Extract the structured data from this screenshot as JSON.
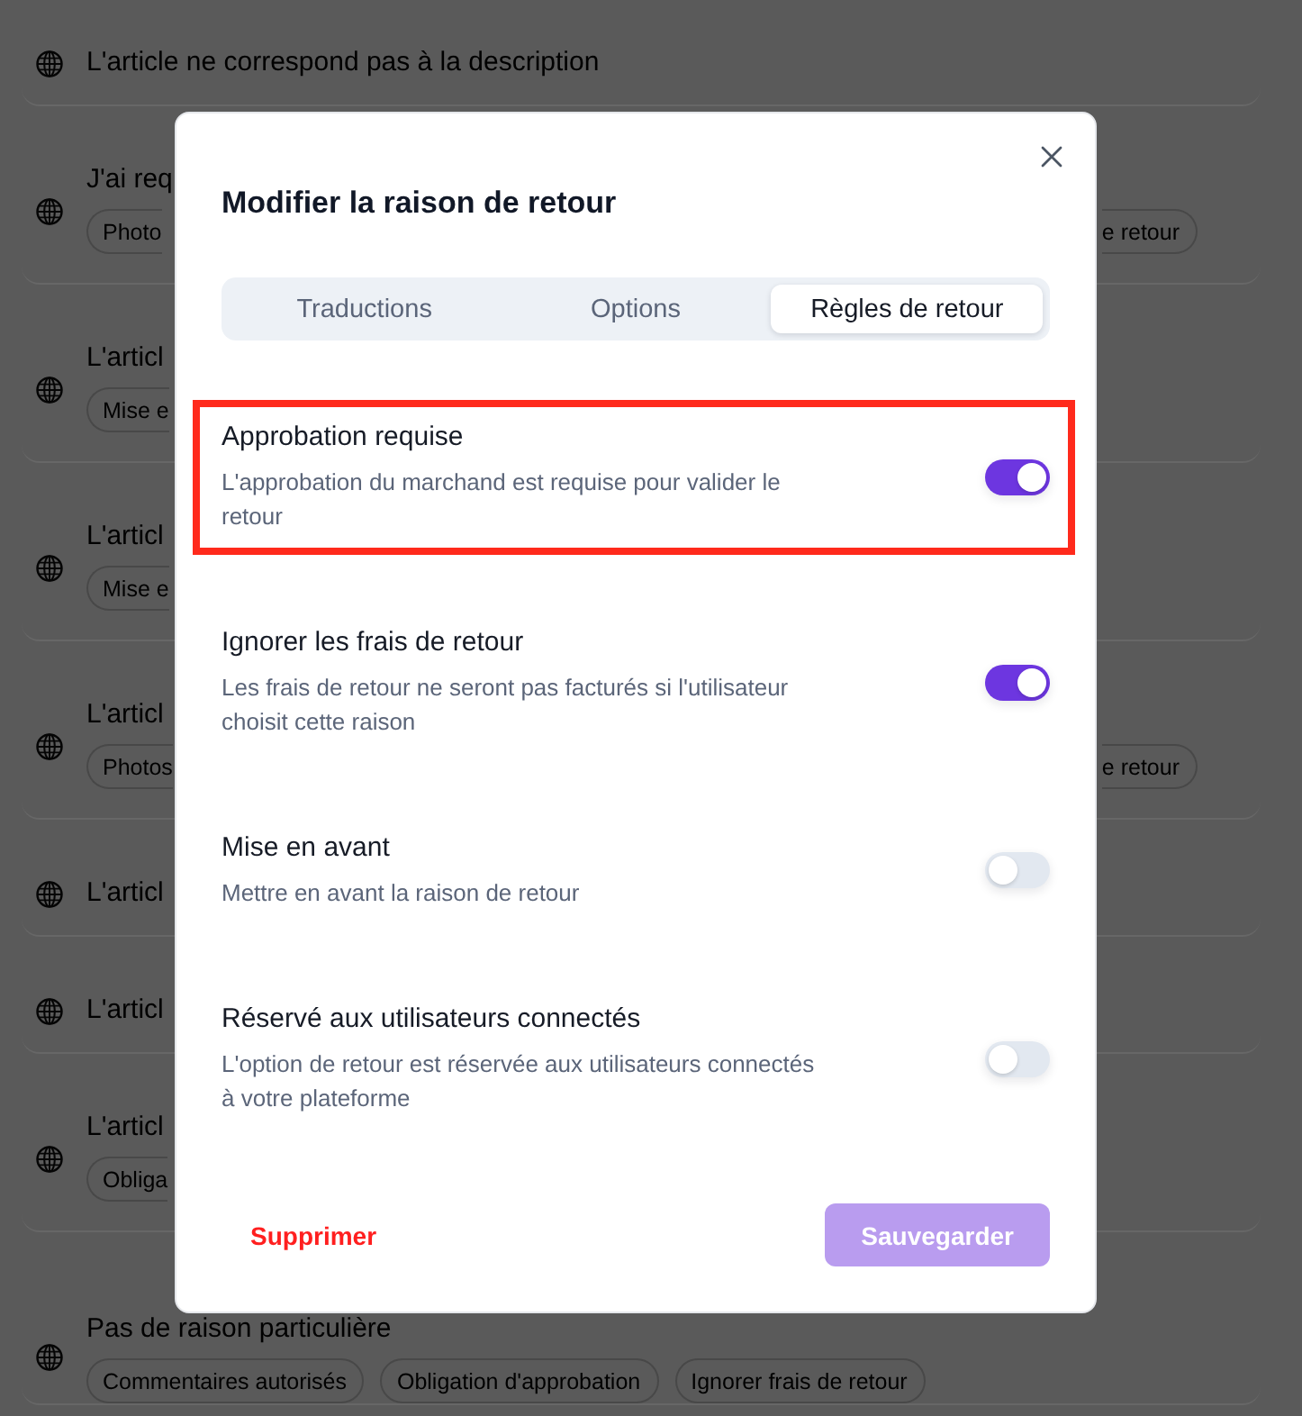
{
  "background_list": {
    "rows": [
      {
        "kind": "full",
        "title": "L'article ne correspond pas à la description"
      },
      {
        "kind": "clipped",
        "title": "J'ai req",
        "tags": [
          "Photo"
        ],
        "end_tags": [
          "e retour"
        ]
      },
      {
        "kind": "clipped",
        "title": "L'articl",
        "tags": [
          "Mise e"
        ]
      },
      {
        "kind": "clipped",
        "title": "L'articl",
        "tags": [
          "Mise e"
        ]
      },
      {
        "kind": "clipped",
        "title": "L'articl",
        "tags": [
          "Photos"
        ],
        "end_tags": [
          "e retour"
        ]
      },
      {
        "kind": "clipped",
        "title": "L'articl"
      },
      {
        "kind": "clipped",
        "title": "L'articl"
      },
      {
        "kind": "clipped",
        "title": "L'articl",
        "tags": [
          "Obliga"
        ]
      },
      {
        "kind": "full",
        "title": "Pas de raison particulière",
        "tags": [
          "Commentaires autorisés",
          "Obligation d'approbation",
          "Ignorer frais de retour"
        ]
      }
    ]
  },
  "dialog": {
    "title": "Modifier la raison de retour",
    "tabs": [
      {
        "label": "Traductions",
        "selected": false
      },
      {
        "label": "Options",
        "selected": false
      },
      {
        "label": "Règles de retour",
        "selected": true
      }
    ],
    "rules": [
      {
        "title": "Approbation requise",
        "description": "L'approbation du marchand est requise pour valider le retour",
        "on": true,
        "highlighted": true
      },
      {
        "title": "Ignorer les frais de retour",
        "description": "Les frais de retour ne seront pas facturés si l'utilisateur choisit cette raison",
        "on": true,
        "highlighted": false
      },
      {
        "title": "Mise en avant",
        "description": "Mettre en avant la raison de retour",
        "on": false,
        "highlighted": false
      },
      {
        "title": "Réservé aux utilisateurs connectés",
        "description": "L'option de retour est réservée aux utilisateurs connectés à votre plateforme",
        "on": false,
        "highlighted": false
      }
    ],
    "delete_button": {
      "label": "Supprimer"
    },
    "save_button": {
      "label": "Sauvegarder",
      "disabled": true
    }
  }
}
